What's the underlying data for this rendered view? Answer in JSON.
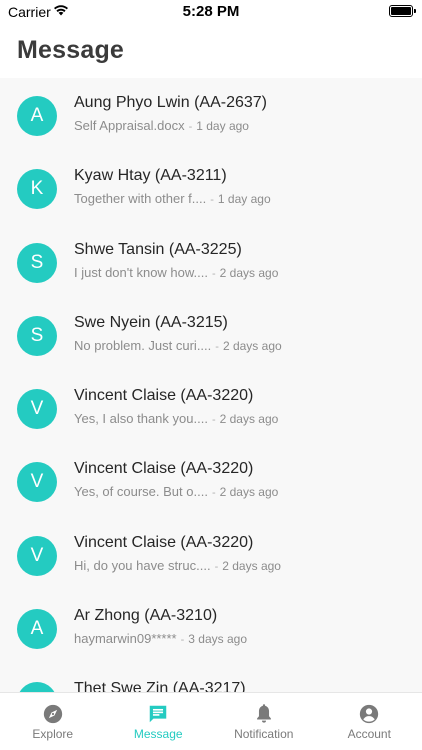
{
  "status_bar": {
    "carrier": "Carrier",
    "time": "5:28 PM"
  },
  "header": {
    "title": "Message"
  },
  "messages": [
    {
      "initial": "A",
      "name": "Aung Phyo Lwin (AA-2637)",
      "preview": "Self Appraisal.docx",
      "time": "1 day ago"
    },
    {
      "initial": "K",
      "name": "Kyaw Htay (AA-3211)",
      "preview": "Together with other f....",
      "time": "1 day ago"
    },
    {
      "initial": "S",
      "name": "Shwe Tansin (AA-3225)",
      "preview": "I just don't know how....",
      "time": "2 days ago"
    },
    {
      "initial": "S",
      "name": "Swe Nyein (AA-3215)",
      "preview": "No problem. Just curi....",
      "time": "2 days ago"
    },
    {
      "initial": "V",
      "name": "Vincent Claise (AA-3220)",
      "preview": "Yes, I also thank you....",
      "time": "2 days ago"
    },
    {
      "initial": "V",
      "name": "Vincent Claise (AA-3220)",
      "preview": "Yes, of course. But o....",
      "time": "2 days ago"
    },
    {
      "initial": "V",
      "name": "Vincent Claise (AA-3220)",
      "preview": "Hi, do you have struc....",
      "time": "2 days ago"
    },
    {
      "initial": "A",
      "name": "Ar Zhong (AA-3210)",
      "preview": "haymarwin09*****",
      "time": "3 days ago"
    },
    {
      "initial": "T",
      "name": "Thet Swe Zin (AA-3217)",
      "preview": "",
      "time": ""
    }
  ],
  "separator": "-",
  "tabs": [
    {
      "label": "Explore",
      "icon": "compass-icon",
      "active": false
    },
    {
      "label": "Message",
      "icon": "chat-icon",
      "active": true
    },
    {
      "label": "Notification",
      "icon": "bell-icon",
      "active": false
    },
    {
      "label": "Account",
      "icon": "account-icon",
      "active": false
    }
  ],
  "colors": {
    "accent": "#24cbc1",
    "list_background": "#f8f8f8",
    "inactive_tab": "#7a7a7a"
  }
}
